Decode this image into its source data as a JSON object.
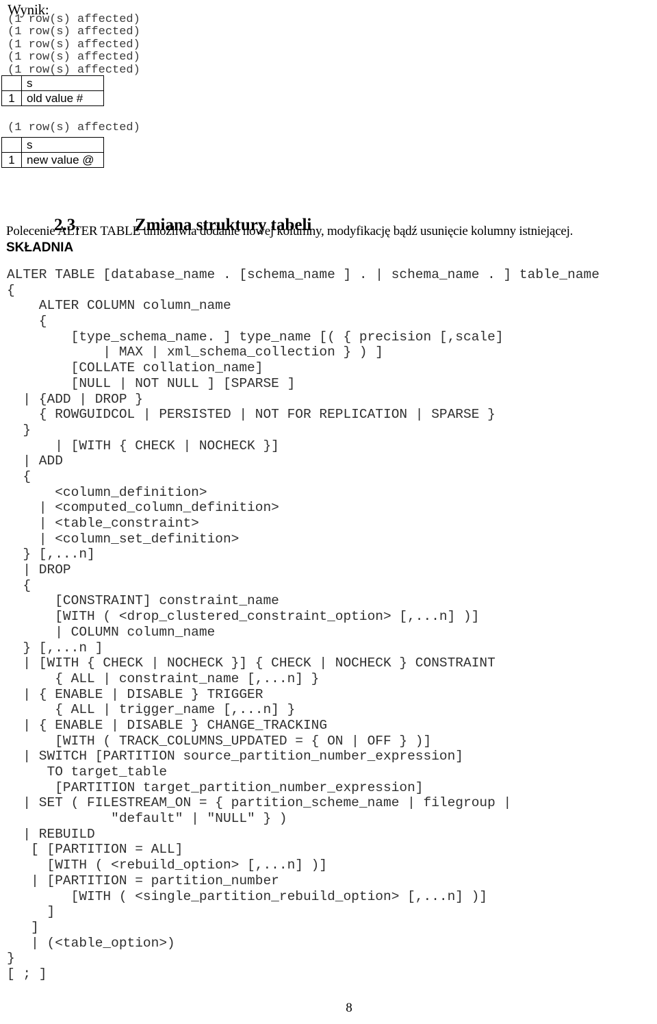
{
  "document": {
    "page_number": "8"
  },
  "result_section": {
    "label": "Wynik:",
    "affected_first": "(1 row(s) affected)\n(1 row(s) affected)\n(1 row(s) affected)\n(1 row(s) affected)\n(1 row(s) affected)",
    "affected_second": "(1 row(s) affected)",
    "grid_first": {
      "header": {
        "index": "",
        "value": "s"
      },
      "row": {
        "index": "1",
        "value": "old value #"
      }
    },
    "grid_second": {
      "header": {
        "index": "",
        "value": "s"
      },
      "row": {
        "index": "1",
        "value": "new value @"
      }
    }
  },
  "section": {
    "number": "2.3.",
    "title": "Zmiana struktury tabeli",
    "paragraph": "Polecenie ALTER TABLE umożliwia dodanie nowej kolumny, modyfikację bądź usunięcie kolumny istniejącej.",
    "subheading": "SKŁADNIA"
  },
  "syntax": {
    "lines": [
      "ALTER TABLE [database_name . [schema_name ] . | schema_name . ] table_name",
      "{",
      "    ALTER COLUMN column_name",
      "    {",
      "        [type_schema_name. ] type_name [( { precision [,scale]",
      "            | MAX | xml_schema_collection } ) ]",
      "        [COLLATE collation_name]",
      "        [NULL | NOT NULL ] [SPARSE ]",
      "  | {ADD | DROP }",
      "    { ROWGUIDCOL | PERSISTED | NOT FOR REPLICATION | SPARSE }",
      "  }",
      "      | [WITH { CHECK | NOCHECK }]",
      "  | ADD",
      "  {",
      "      <column_definition>",
      "    | <computed_column_definition>",
      "    | <table_constraint>",
      "    | <column_set_definition>",
      "  } [,...n]",
      "  | DROP",
      "  {",
      "      [CONSTRAINT] constraint_name",
      "      [WITH ( <drop_clustered_constraint_option> [,...n] )]",
      "      | COLUMN column_name",
      "  } [,...n ]",
      "  | [WITH { CHECK | NOCHECK }] { CHECK | NOCHECK } CONSTRAINT",
      "      { ALL | constraint_name [,...n] }",
      "  | { ENABLE | DISABLE } TRIGGER",
      "      { ALL | trigger_name [,...n] }",
      "  | { ENABLE | DISABLE } CHANGE_TRACKING",
      "      [WITH ( TRACK_COLUMNS_UPDATED = { ON | OFF } )]",
      "  | SWITCH [PARTITION source_partition_number_expression]",
      "     TO target_table",
      "      [PARTITION target_partition_number_expression]",
      "  | SET ( FILESTREAM_ON = { partition_scheme_name | filegroup |",
      "             \"default\" | \"NULL\" } )",
      "  | REBUILD",
      "   [ [PARTITION = ALL]",
      "     [WITH ( <rebuild_option> [,...n] )]",
      "   | [PARTITION = partition_number",
      "        [WITH ( <single_partition_rebuild_option> [,...n] )]",
      "     ]",
      "   ]",
      "   | (<table_option>)",
      "}",
      "[ ; ]"
    ]
  }
}
